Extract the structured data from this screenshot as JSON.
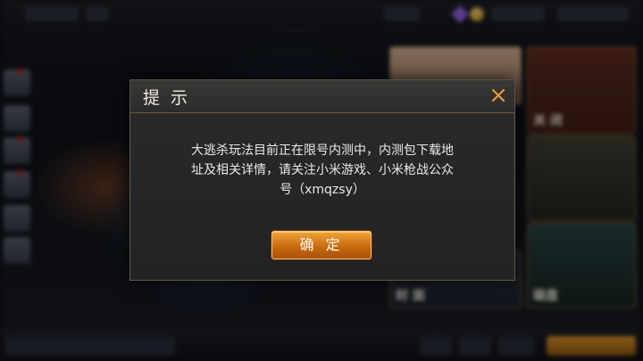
{
  "dialog": {
    "title": "提 示",
    "message": "大逃杀玩法目前正在限号内测中，内测包下载地\n址及相关详情，请关注小米游戏、小米枪战公众\n号（xmqzsy）",
    "confirm_label": "确 定",
    "close_icon": "close-icon"
  },
  "background": {
    "tiles": [
      {
        "label": "关 闭"
      },
      {
        "label": "封 面"
      },
      {
        "label": "磁盘"
      }
    ]
  },
  "colors": {
    "accent_orange": "#e08a20",
    "dialog_bg": "#262628",
    "border_gold": "#8a6d3a",
    "close_orange": "#e39a3a"
  }
}
